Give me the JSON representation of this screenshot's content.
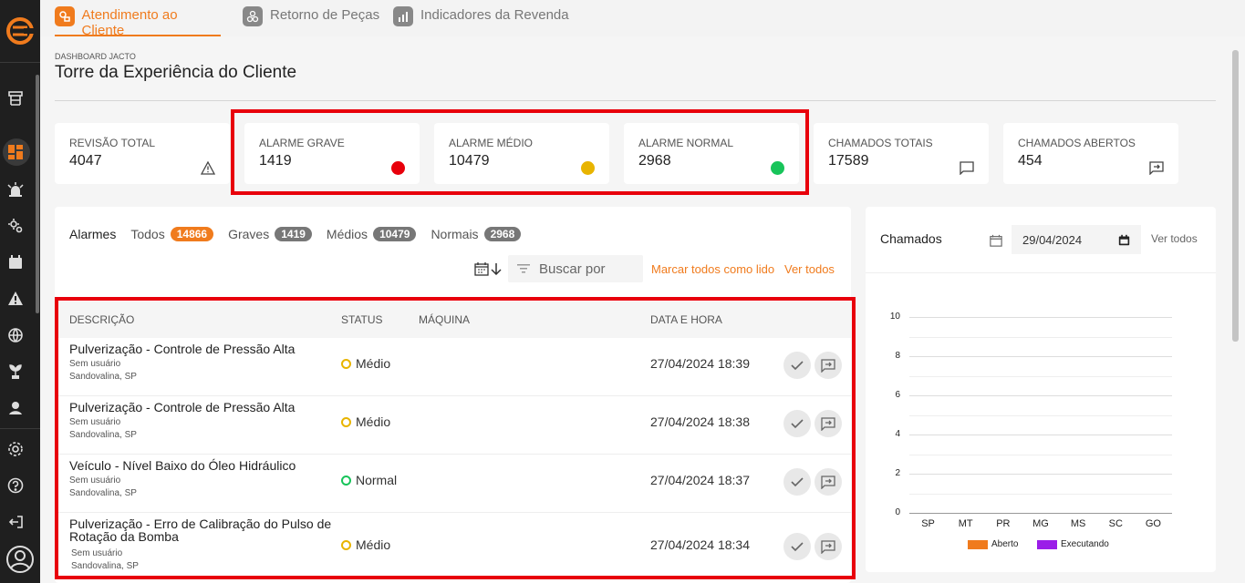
{
  "tabs": [
    {
      "label": "Atendimento ao Cliente",
      "active": true
    },
    {
      "label": "Retorno de Peças",
      "active": false
    },
    {
      "label": "Indicadores da Revenda",
      "active": false
    }
  ],
  "header": {
    "breadcrumb": "DASHBOARD JACTO",
    "title": "Torre da Experiência do Cliente"
  },
  "kpis": [
    {
      "label": "REVISÃO TOTAL",
      "value": "4047",
      "icon": "warning-icon"
    },
    {
      "label": "ALARME GRAVE",
      "value": "1419",
      "icon": "red-dot",
      "color": "#e8000b"
    },
    {
      "label": "ALARME MÉDIO",
      "value": "10479",
      "icon": "yellow-dot",
      "color": "#e8b400"
    },
    {
      "label": "ALARME NORMAL",
      "value": "2968",
      "icon": "green-dot",
      "color": "#18c45a"
    },
    {
      "label": "CHAMADOS TOTAIS",
      "value": "17589",
      "icon": "chat-icon"
    },
    {
      "label": "CHAMADOS ABERTOS",
      "value": "454",
      "icon": "ticket-icon"
    }
  ],
  "alarms": {
    "title": "Alarmes",
    "filters": [
      {
        "label": "Todos",
        "count": "14866"
      },
      {
        "label": "Graves",
        "count": "1419"
      },
      {
        "label": "Médios",
        "count": "10479"
      },
      {
        "label": "Normais",
        "count": "2968"
      }
    ],
    "search_placeholder": "Buscar por",
    "mark_all": "Marcar todos como lido",
    "see_all": "Ver todos",
    "columns": [
      "DESCRIÇÃO",
      "STATUS",
      "MÁQUINA",
      "DATA E HORA"
    ],
    "rows": [
      {
        "desc": "Pulverização - Controle de Pressão Alta",
        "user": "Sem usuário",
        "loc": "Sandovalina, SP",
        "status": "Médio",
        "machine": "",
        "datetime": "27/04/2024 18:39"
      },
      {
        "desc": "Pulverização - Controle de Pressão Alta",
        "user": "Sem usuário",
        "loc": "Sandovalina, SP",
        "status": "Médio",
        "machine": "",
        "datetime": "27/04/2024 18:38"
      },
      {
        "desc": "Veículo - Nível Baixo do Óleo Hidráulico",
        "user": "Sem usuário",
        "loc": "Sandovalina, SP",
        "status": "Normal",
        "machine": "",
        "datetime": "27/04/2024 18:37"
      },
      {
        "desc": "Pulverização - Erro de Calibração do Pulso de Rotação da Bomba",
        "user": "Sem usuário",
        "loc": "Sandovalina, SP",
        "status": "Médio",
        "machine": "",
        "datetime": "27/04/2024 18:34"
      }
    ]
  },
  "calls": {
    "title": "Chamados",
    "date": "29/04/2024",
    "see_all": "Ver todos"
  },
  "chart_data": {
    "type": "bar",
    "categories": [
      "SP",
      "MT",
      "PR",
      "MG",
      "MS",
      "SC",
      "GO"
    ],
    "series": [
      {
        "name": "Aberto",
        "color": "#f07b1d",
        "values": [
          0,
          0,
          0,
          0,
          0,
          0,
          0
        ]
      },
      {
        "name": "Executando",
        "color": "#9b1de8",
        "values": [
          0,
          0,
          0,
          0,
          0,
          0,
          0
        ]
      }
    ],
    "yticks": [
      "0",
      "2",
      "4",
      "6",
      "8",
      "10"
    ],
    "ylim": [
      0,
      10
    ],
    "grid": true,
    "legend": "bottom"
  }
}
